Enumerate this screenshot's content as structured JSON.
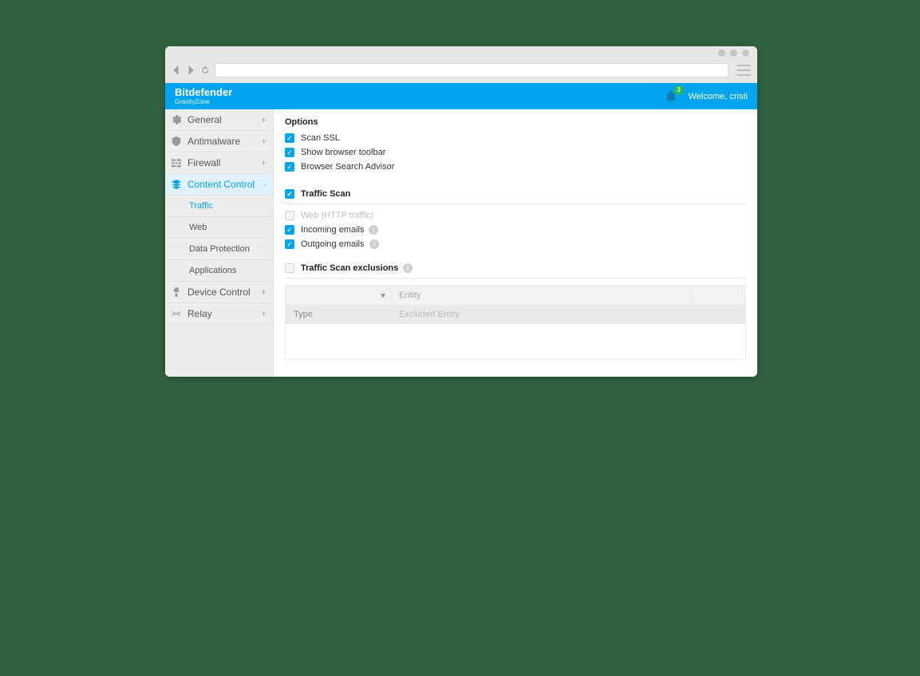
{
  "browser": {
    "url": ""
  },
  "brand": {
    "name": "Bitdefender",
    "sub": "GravityZone"
  },
  "header": {
    "welcome": "Welcome, cristi",
    "badge": "3"
  },
  "sidebar": {
    "general": "General",
    "antimalware": "Antimalware",
    "firewall": "Firewall",
    "content_control": "Content Control",
    "device_control": "Device Control",
    "relay": "Relay",
    "sub_traffic": "Traffic",
    "sub_web": "Web",
    "sub_data_protection": "Data Protection",
    "sub_applications": "Applications"
  },
  "options": {
    "title": "Options",
    "scan_ssl": "Scan SSL",
    "show_toolbar": "Show browser toolbar",
    "search_advisor": "Browser Search Advisor"
  },
  "traffic": {
    "title": "Traffic Scan",
    "web_http": "Web (HTTP traffic)",
    "incoming": "Incoming emails",
    "outgoing": "Outgoing emails"
  },
  "exclusions": {
    "title": "Traffic Scan exclusions",
    "entity_placeholder": "Entity",
    "col_type": "Type",
    "col_entity": "Excluded Entity"
  }
}
